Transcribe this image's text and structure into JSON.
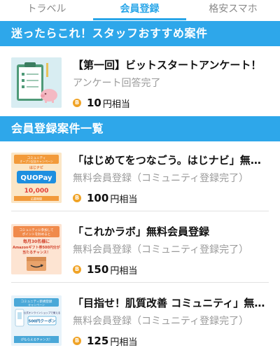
{
  "tabs": [
    {
      "label": "トラベル"
    },
    {
      "label": "会員登録"
    },
    {
      "label": "格安スマホ"
    }
  ],
  "featured": {
    "header": "迷ったらこれ！スタッフおすすめ案件",
    "items": [
      {
        "title": "【第一回】ビットスタートアンケート！",
        "subtitle": "アンケート回答完了",
        "points": "10",
        "unit": "円相当",
        "coin": "B",
        "thumb_icon": "survey-clipboard-icon"
      }
    ]
  },
  "list": {
    "header": "会員登録案件一覧",
    "items": [
      {
        "title": "「はじめてをつなごう。はじナビ」無料会員登録",
        "subtitle": "無料会員登録（コミュニティ登録完了）",
        "points": "100",
        "unit": "円相当",
        "coin": "B",
        "thumb": {
          "line1": "コミュニティ",
          "line2": "オープン記念キャンペーン",
          "brand": "はじナビ",
          "pay": "QUOPay",
          "amount": "10,000",
          "note": "応募期間"
        }
      },
      {
        "title": "「これかラボ」無料会員登録",
        "subtitle": "無料会員登録（コミュニティ登録完了）",
        "points": "150",
        "unit": "円相当",
        "coin": "B",
        "thumb": {
          "line1": "コミュニティに参加して",
          "line2": "ポイントを貯めると",
          "line3": "毎月30名様に",
          "line4": "Amazonギフト券500円分が",
          "line5": "当たるチャンス！"
        }
      },
      {
        "title": "「目指せ！肌質改善 コミュニティ」無料会員登録",
        "subtitle": "無料会員登録（コミュニティ登録完了）",
        "points": "125",
        "unit": "円相当",
        "coin": "B",
        "thumb": {
          "line1": "コミュニティ新規登録",
          "line2": "キャンペーン",
          "line3": "公式オンラインショップで使える",
          "line4": "500円クーポン",
          "line5": "がもらえるチャンス！"
        }
      }
    ]
  },
  "colors": {
    "accent": "#2ea7ea",
    "coin": "#f0a326",
    "subtitle": "#9a9a9a"
  }
}
